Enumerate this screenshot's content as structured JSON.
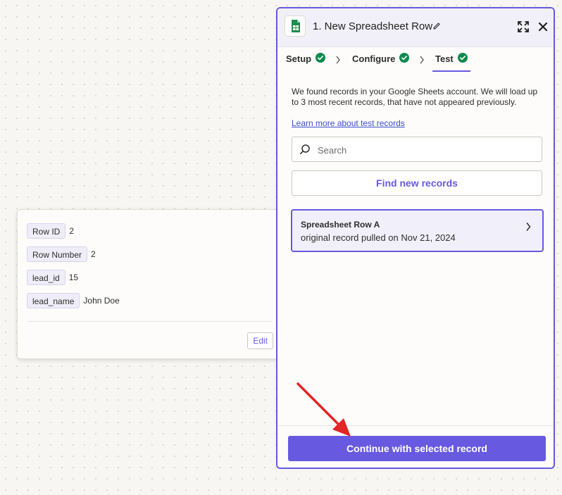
{
  "panel": {
    "title": "1. New Spreadsheet Row",
    "app_icon": "google-sheets-icon",
    "tabs": [
      {
        "label": "Setup",
        "status": "complete"
      },
      {
        "label": "Configure",
        "status": "complete"
      },
      {
        "label": "Test",
        "status": "complete",
        "active": true
      }
    ],
    "intro_text": "We found records in your Google Sheets account. We will load up to 3 most recent records, that have not appeared previously.",
    "learn_link": "Learn more about test records",
    "search": {
      "placeholder": "Search",
      "value": ""
    },
    "find_button": "Find new records",
    "record": {
      "title": "Spreadsheet Row A",
      "subtitle": "original record pulled on Nov 21, 2024"
    },
    "continue_button": "Continue with selected record"
  },
  "popover": {
    "fields": [
      {
        "key": "Row ID",
        "value": "2"
      },
      {
        "key": "Row Number",
        "value": "2"
      },
      {
        "key": "lead_id",
        "value": "15"
      },
      {
        "key": "lead_name",
        "value": "John Doe"
      }
    ],
    "edit_button": "Edit"
  },
  "colors": {
    "accent": "#6759e0",
    "success": "#0f8a4f",
    "annotation_arrow": "#e02626"
  }
}
